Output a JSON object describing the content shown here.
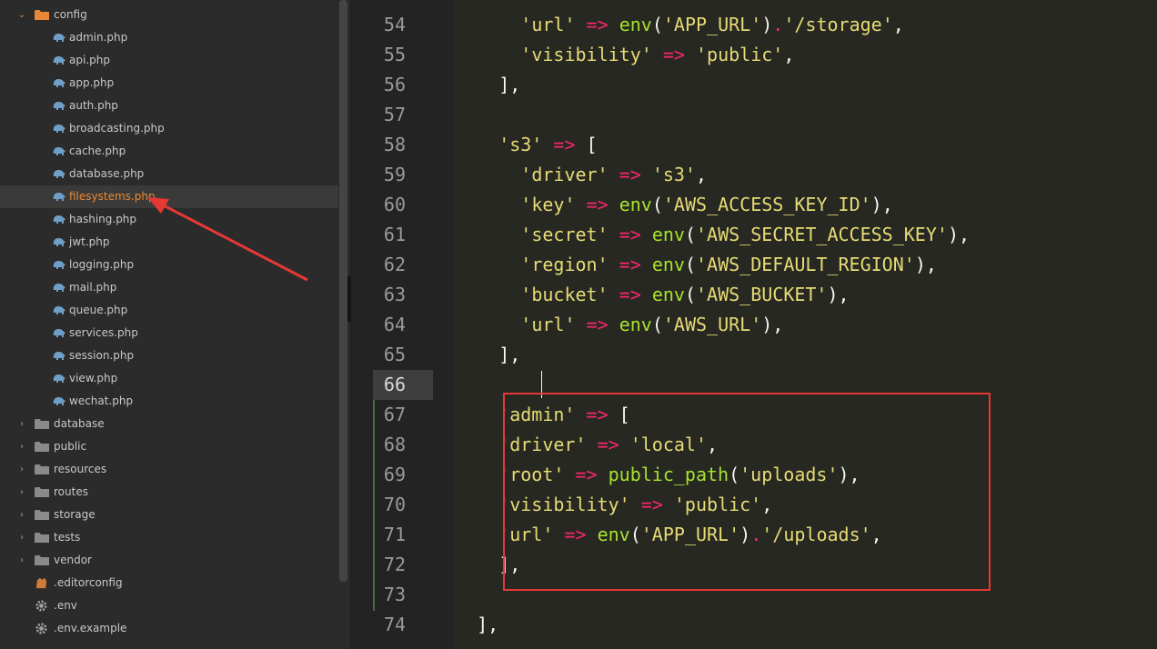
{
  "sidebar": {
    "folder_open": "config",
    "files": [
      "admin.php",
      "api.php",
      "app.php",
      "auth.php",
      "broadcasting.php",
      "cache.php",
      "database.php",
      "filesystems.php",
      "hashing.php",
      "jwt.php",
      "logging.php",
      "mail.php",
      "queue.php",
      "services.php",
      "session.php",
      "view.php",
      "wechat.php"
    ],
    "active_file_index": 7,
    "folders": [
      "database",
      "public",
      "resources",
      "routes",
      "storage",
      "tests",
      "vendor"
    ],
    "root_files": [
      {
        "name": ".editorconfig",
        "icon": "editorconfig-icon"
      },
      {
        "name": ".env",
        "icon": "gear-icon"
      },
      {
        "name": ".env.example",
        "icon": "gear-icon"
      }
    ],
    "collapse_glyph": "‹"
  },
  "editor": {
    "current_line": 66,
    "lines": [
      {
        "num": "54",
        "indent": 6,
        "tokens": [
          [
            "'url'",
            "s"
          ],
          [
            " ",
            "p"
          ],
          [
            "=>",
            "o"
          ],
          [
            " ",
            "p"
          ],
          [
            "env",
            "f"
          ],
          [
            "(",
            "p"
          ],
          [
            "'APP_URL'",
            "s"
          ],
          [
            ")",
            "p"
          ],
          [
            ".",
            "o"
          ],
          [
            "'/storage'",
            "s"
          ],
          [
            ",",
            "p"
          ]
        ]
      },
      {
        "num": "55",
        "indent": 6,
        "tokens": [
          [
            "'visibility'",
            "s"
          ],
          [
            " ",
            "p"
          ],
          [
            "=>",
            "o"
          ],
          [
            " ",
            "p"
          ],
          [
            "'public'",
            "s"
          ],
          [
            ",",
            "p"
          ]
        ]
      },
      {
        "num": "56",
        "indent": 4,
        "tokens": [
          [
            "],",
            "p"
          ]
        ]
      },
      {
        "num": "57",
        "indent": 0,
        "tokens": []
      },
      {
        "num": "58",
        "indent": 4,
        "tokens": [
          [
            "'s3'",
            "s"
          ],
          [
            " ",
            "p"
          ],
          [
            "=>",
            "o"
          ],
          [
            " ",
            "p"
          ],
          [
            "[",
            "p"
          ]
        ]
      },
      {
        "num": "59",
        "indent": 6,
        "tokens": [
          [
            "'driver'",
            "s"
          ],
          [
            " ",
            "p"
          ],
          [
            "=>",
            "o"
          ],
          [
            " ",
            "p"
          ],
          [
            "'s3'",
            "s"
          ],
          [
            ",",
            "p"
          ]
        ]
      },
      {
        "num": "60",
        "indent": 6,
        "tokens": [
          [
            "'key'",
            "s"
          ],
          [
            " ",
            "p"
          ],
          [
            "=>",
            "o"
          ],
          [
            " ",
            "p"
          ],
          [
            "env",
            "f"
          ],
          [
            "(",
            "p"
          ],
          [
            "'AWS_ACCESS_KEY_ID'",
            "s"
          ],
          [
            "),",
            "p"
          ]
        ]
      },
      {
        "num": "61",
        "indent": 6,
        "tokens": [
          [
            "'secret'",
            "s"
          ],
          [
            " ",
            "p"
          ],
          [
            "=>",
            "o"
          ],
          [
            " ",
            "p"
          ],
          [
            "env",
            "f"
          ],
          [
            "(",
            "p"
          ],
          [
            "'AWS_SECRET_ACCESS_KEY'",
            "s"
          ],
          [
            "),",
            "p"
          ]
        ]
      },
      {
        "num": "62",
        "indent": 6,
        "tokens": [
          [
            "'region'",
            "s"
          ],
          [
            " ",
            "p"
          ],
          [
            "=>",
            "o"
          ],
          [
            " ",
            "p"
          ],
          [
            "env",
            "f"
          ],
          [
            "(",
            "p"
          ],
          [
            "'AWS_DEFAULT_REGION'",
            "s"
          ],
          [
            "),",
            "p"
          ]
        ]
      },
      {
        "num": "63",
        "indent": 6,
        "tokens": [
          [
            "'bucket'",
            "s"
          ],
          [
            " ",
            "p"
          ],
          [
            "=>",
            "o"
          ],
          [
            " ",
            "p"
          ],
          [
            "env",
            "f"
          ],
          [
            "(",
            "p"
          ],
          [
            "'AWS_BUCKET'",
            "s"
          ],
          [
            "),",
            "p"
          ]
        ]
      },
      {
        "num": "64",
        "indent": 6,
        "tokens": [
          [
            "'url'",
            "s"
          ],
          [
            " ",
            "p"
          ],
          [
            "=>",
            "o"
          ],
          [
            " ",
            "p"
          ],
          [
            "env",
            "f"
          ],
          [
            "(",
            "p"
          ],
          [
            "'AWS_URL'",
            "s"
          ],
          [
            "),",
            "p"
          ]
        ]
      },
      {
        "num": "65",
        "indent": 4,
        "tokens": [
          [
            "],",
            "p"
          ]
        ]
      },
      {
        "num": "66",
        "indent": 0,
        "tokens": []
      },
      {
        "num": "67",
        "indent": 4,
        "tokens": [
          [
            "'admin'",
            "s"
          ],
          [
            " ",
            "p"
          ],
          [
            "=>",
            "o"
          ],
          [
            " ",
            "p"
          ],
          [
            "[",
            "p"
          ]
        ]
      },
      {
        "num": "68",
        "indent": 4,
        "tokens": [
          [
            "'driver'",
            "s"
          ],
          [
            " ",
            "p"
          ],
          [
            "=>",
            "o"
          ],
          [
            " ",
            "p"
          ],
          [
            "'local'",
            "s"
          ],
          [
            ",",
            "p"
          ]
        ]
      },
      {
        "num": "69",
        "indent": 4,
        "tokens": [
          [
            "'root'",
            "s"
          ],
          [
            " ",
            "p"
          ],
          [
            "=>",
            "o"
          ],
          [
            " ",
            "p"
          ],
          [
            "public_path",
            "f"
          ],
          [
            "(",
            "p"
          ],
          [
            "'uploads'",
            "s"
          ],
          [
            "),",
            "p"
          ]
        ]
      },
      {
        "num": "70",
        "indent": 4,
        "tokens": [
          [
            "'visibility'",
            "s"
          ],
          [
            " ",
            "p"
          ],
          [
            "=>",
            "o"
          ],
          [
            " ",
            "p"
          ],
          [
            "'public'",
            "s"
          ],
          [
            ",",
            "p"
          ]
        ]
      },
      {
        "num": "71",
        "indent": 4,
        "tokens": [
          [
            "'url'",
            "s"
          ],
          [
            " ",
            "p"
          ],
          [
            "=>",
            "o"
          ],
          [
            " ",
            "p"
          ],
          [
            "env",
            "f"
          ],
          [
            "(",
            "p"
          ],
          [
            "'APP_URL'",
            "s"
          ],
          [
            ")",
            "p"
          ],
          [
            ".",
            "o"
          ],
          [
            "'/uploads'",
            "s"
          ],
          [
            ",",
            "p"
          ]
        ]
      },
      {
        "num": "72",
        "indent": 4,
        "tokens": [
          [
            "],",
            "p"
          ]
        ]
      },
      {
        "num": "73",
        "indent": 0,
        "tokens": []
      },
      {
        "num": "74",
        "indent": 2,
        "tokens": [
          [
            "],",
            "p"
          ]
        ]
      }
    ]
  },
  "colors": {
    "string": "#e6db74",
    "operator": "#f92672",
    "function": "#a6e22e",
    "highlight_box": "#e53935",
    "active_file": "#ee8833"
  }
}
